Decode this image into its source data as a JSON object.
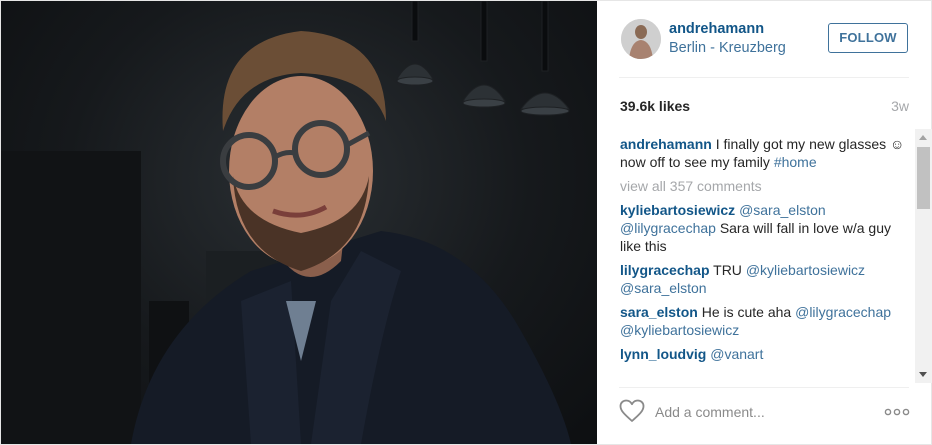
{
  "post": {
    "author": {
      "username": "andrehamann",
      "location": "Berlin - Kreuzberg",
      "follow_label": "FOLLOW"
    },
    "likes": "39.6k likes",
    "time": "3w",
    "caption": {
      "author": "andrehamann",
      "text": "I finally got my new glasses ☺ now off to see my family",
      "hashtag": "#home"
    },
    "view_all": "view all 357 comments",
    "comments": [
      {
        "author": "kyliebartosiewicz",
        "mentions": [
          "@sara_elston",
          "@lilygracechap"
        ],
        "text": "Sara will fall in love w/a guy like this"
      },
      {
        "author": "lilygracechap",
        "text": "TRU",
        "mentions": [
          "@kyliebartosiewicz",
          "@sara_elston"
        ]
      },
      {
        "author": "sara_elston",
        "text": "He is cute aha",
        "mentions": [
          "@lilygracechap",
          "@kyliebartosiewicz"
        ]
      },
      {
        "author": "lynn_loudvig",
        "mentions": [
          "@vanart"
        ]
      }
    ],
    "comment_placeholder": "Add a comment...",
    "icons": {
      "like": "heart-icon",
      "more": "more-options-icon"
    },
    "colors": {
      "link": "#125688",
      "mention": "#3f729b",
      "muted": "#a5a7aa"
    }
  }
}
